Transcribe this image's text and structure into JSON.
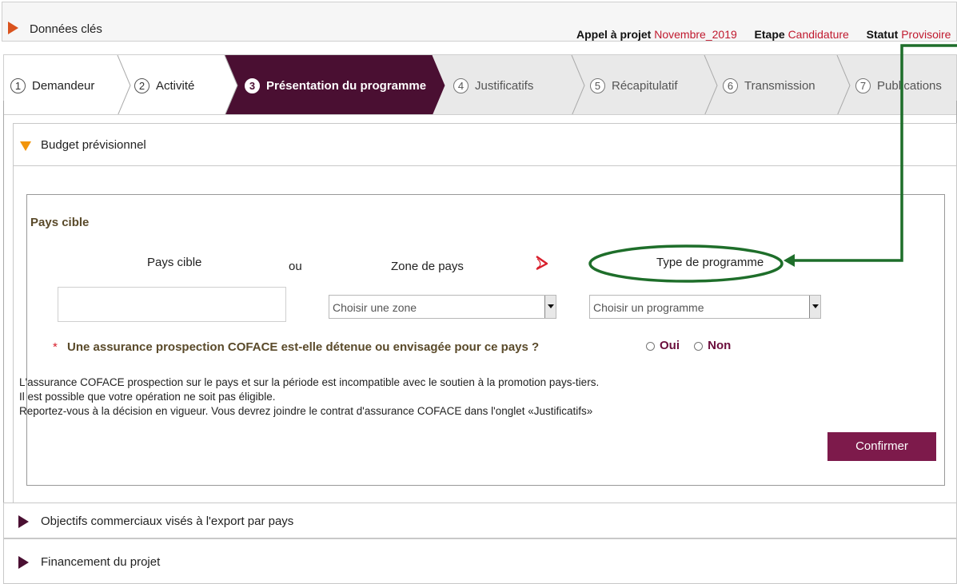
{
  "header": {
    "title": "Données clés",
    "appel_label": "Appel à projet",
    "appel_value": "Novembre_2019",
    "etape_label": "Etape",
    "etape_value": "Candidature",
    "statut_label": "Statut",
    "statut_value": "Provisoire"
  },
  "steps": [
    {
      "num": "1",
      "label": "Demandeur"
    },
    {
      "num": "2",
      "label": "Activité"
    },
    {
      "num": "3",
      "label": "Présentation du programme"
    },
    {
      "num": "4",
      "label": "Justificatifs"
    },
    {
      "num": "5",
      "label": "Récapitulatif"
    },
    {
      "num": "6",
      "label": "Transmission"
    },
    {
      "num": "7",
      "label": "Publications"
    }
  ],
  "budget": {
    "title": "Budget prévisionnel",
    "section_title": "Pays cible",
    "col_pays": "Pays cible",
    "col_ou": "ou",
    "col_zone": "Zone de pays",
    "col_type": "Type de programme",
    "pays_value": "",
    "zone_select": "Choisir une zone",
    "programme_select": "Choisir un programme",
    "question_star": "*",
    "question": "Une assurance prospection COFACE est-elle détenue ou envisagée pour ce pays ?",
    "oui": "Oui",
    "non": "Non",
    "info_lines": [
      "L'assurance COFACE prospection sur le pays et sur la période est incompatible avec le soutien à la promotion pays-tiers.",
      "Il est possible que votre opération ne soit pas éligible.",
      "Reportez-vous à la décision en vigueur. Vous devrez joindre le contrat d'assurance COFACE dans l'onglet «Justificatifs»"
    ],
    "confirm": "Confirmer"
  },
  "accordions": {
    "objectifs": "Objectifs commerciaux visés à l'export par pays",
    "financement": "Financement du projet"
  },
  "colors": {
    "brand": "#4a0f32",
    "button": "#7d1a4b",
    "accent_red": "#c0192e",
    "accent_orange": "#f2950a",
    "annotation_green": "#1e6e2a"
  },
  "icons": {
    "pdf": "pdf-icon",
    "expand": "triangle-right-icon",
    "collapse": "triangle-down-icon"
  }
}
